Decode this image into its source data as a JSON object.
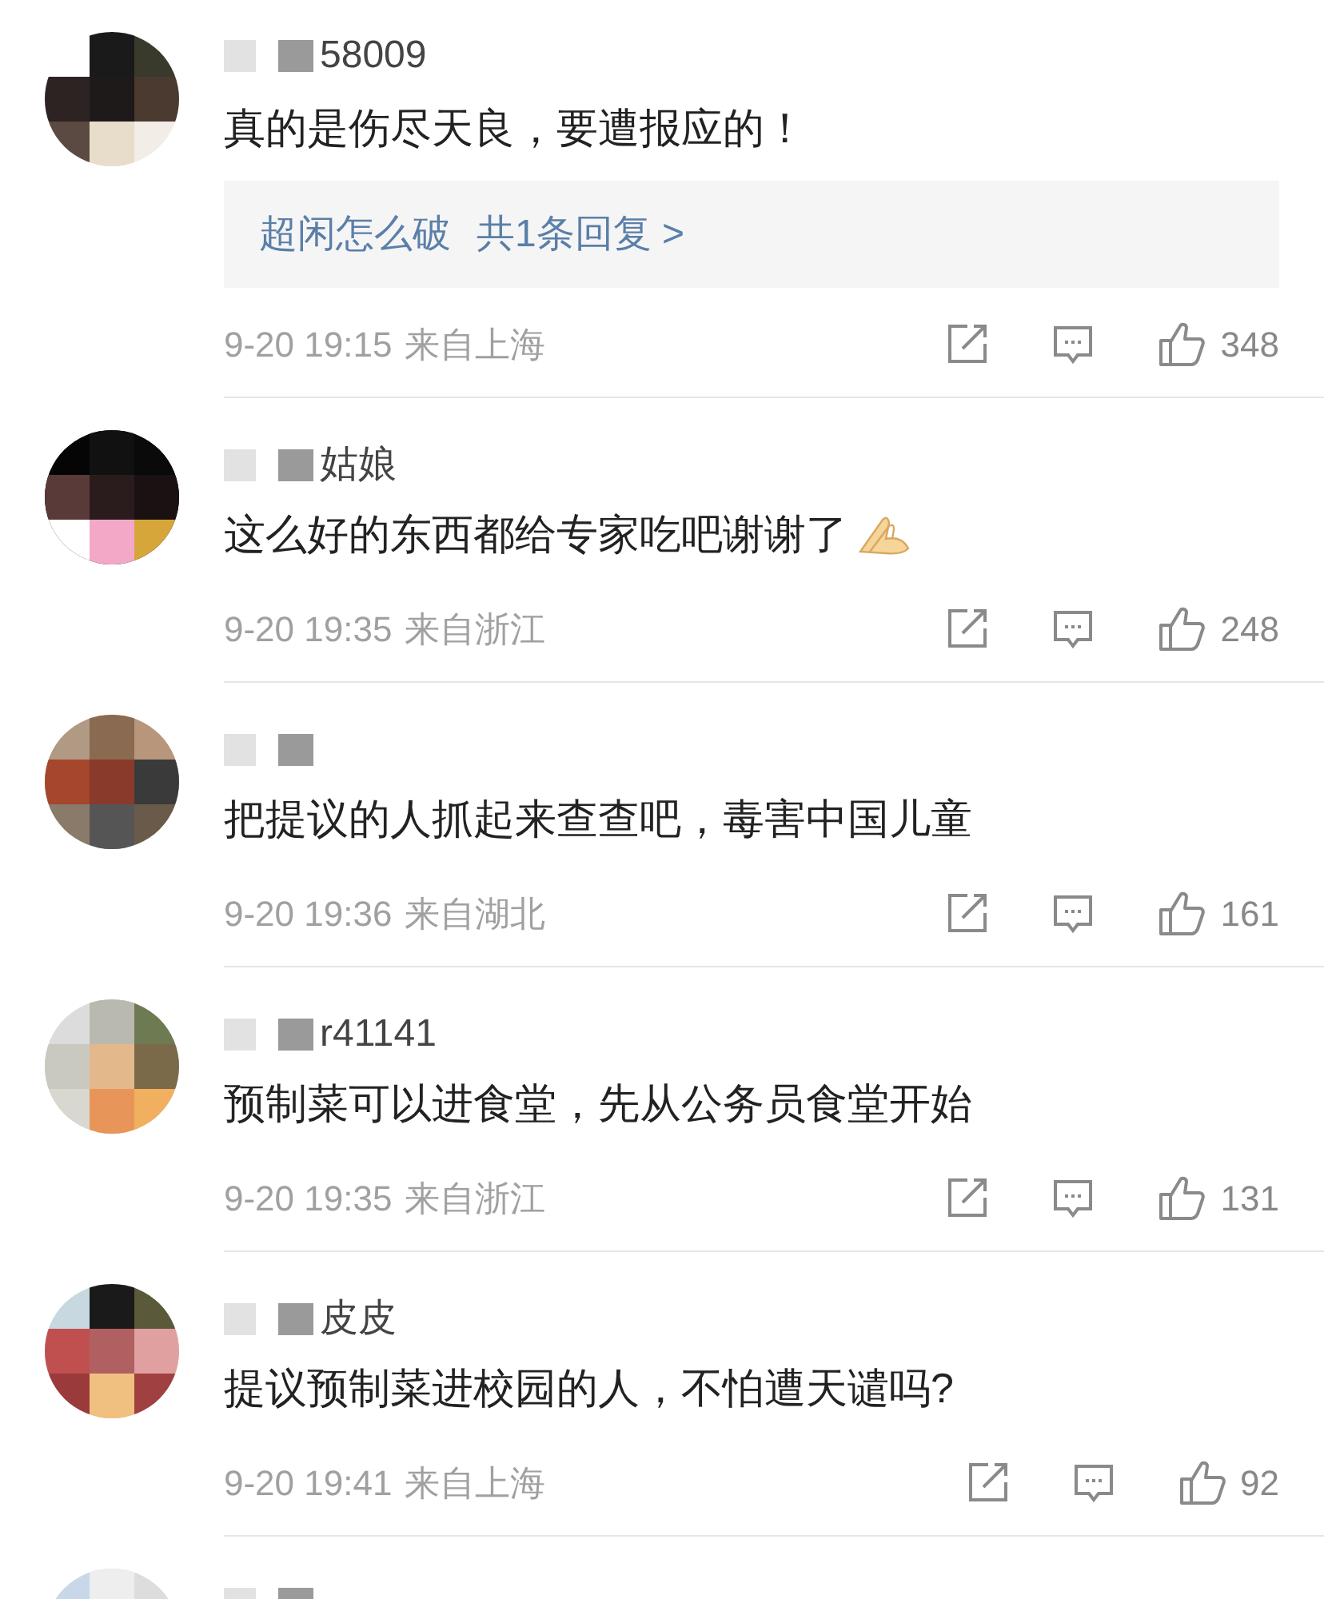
{
  "comments": [
    {
      "kind": "comment",
      "name": "58009",
      "text": "真的是伤尽天良，要遭报应的！",
      "reply": {
        "user": "超闲怎么破",
        "summary": "共1条回复 >"
      },
      "time": "9-20 19:15",
      "location": "来自上海",
      "likes": "348",
      "emoji": false
    },
    {
      "kind": "comment",
      "name": "姑娘",
      "text": "这么好的东西都给专家吃吧谢谢了",
      "time": "9-20 19:35",
      "location": "来自浙江",
      "likes": "248",
      "emoji": true
    },
    {
      "kind": "comment",
      "text": "把提议的人抓起来查查吧，毒害中国儿童",
      "time": "9-20 19:36",
      "location": "来自湖北",
      "likes": "161",
      "emoji": false
    },
    {
      "kind": "comment",
      "name": "r41141",
      "text": "预制菜可以进食堂，先从公务员食堂开始",
      "time": "9-20 19:35",
      "location": "来自浙江",
      "likes": "131",
      "emoji": false
    },
    {
      "kind": "comment",
      "name": "皮皮",
      "text": "提议预制菜进校园的人，不怕遭天谴吗?",
      "time": "9-20 19:41",
      "location": "来自上海",
      "likes": "92",
      "emoji": false
    },
    {
      "kind": "cut_off"
    }
  ]
}
